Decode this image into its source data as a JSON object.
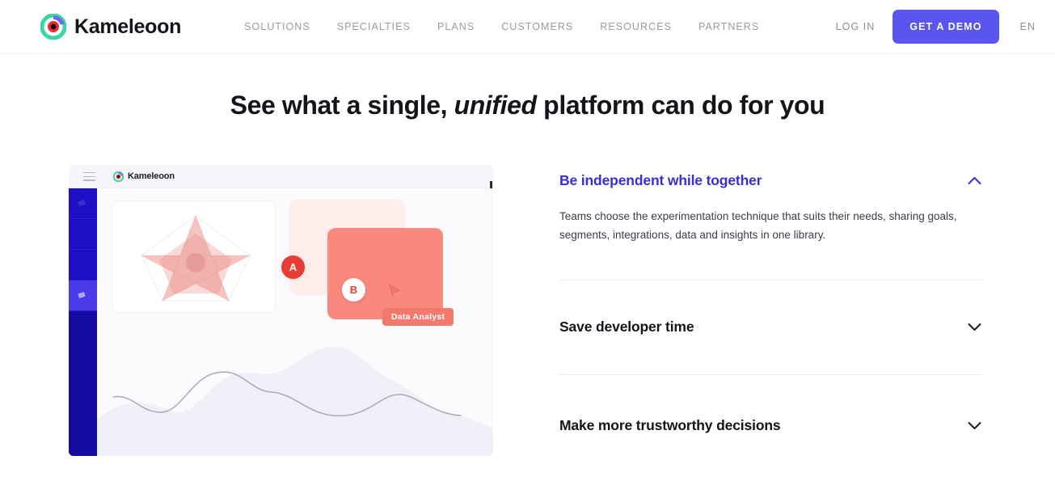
{
  "header": {
    "brand_name": "Kameleoon",
    "brand_icon": "kameleoon-logo-icon",
    "nav": [
      {
        "label": "SOLUTIONS"
      },
      {
        "label": "SPECIALTIES"
      },
      {
        "label": "PLANS"
      },
      {
        "label": "CUSTOMERS"
      },
      {
        "label": "RESOURCES"
      },
      {
        "label": "PARTNERS"
      }
    ],
    "login_label": "LOG IN",
    "demo_label": "GET A DEMO",
    "language": "EN",
    "accent_color": "#5b55f0"
  },
  "hero": {
    "headline_part1": "See what a single, ",
    "headline_emphasis": "unified",
    "headline_part2": " platform can do for you"
  },
  "mockup": {
    "brand_name": "Kameleoon",
    "menu_icon": "hamburger-menu-icon",
    "brand_icon": "kameleoon-logo-icon",
    "variant_a_label": "A",
    "variant_b_label": "B",
    "role_tag": "Data Analyst",
    "cursor_icon": "cursor-arrow-icon",
    "sidebar_color": "#150ba0",
    "sidebar_active_color": "#4b3ae8",
    "variant_a_color": "#fdeeeb",
    "variant_b_color": "#f9897f",
    "badge_a_color": "#e83c34"
  },
  "accordion": {
    "items": [
      {
        "title": "Be independent while together",
        "body": "Teams choose the experimentation technique that suits their needs, sharing goals, segments, integrations, data and insights in one library.",
        "state": "expanded",
        "icon": "chevron-up-icon",
        "title_color": "#3a2ddb"
      },
      {
        "title": "Save developer time",
        "body": "",
        "state": "collapsed",
        "icon": "chevron-down-icon",
        "title_color": "#15141a"
      },
      {
        "title": "Make more trustworthy decisions",
        "body": "",
        "state": "collapsed",
        "icon": "chevron-down-icon",
        "title_color": "#15141a"
      }
    ]
  }
}
